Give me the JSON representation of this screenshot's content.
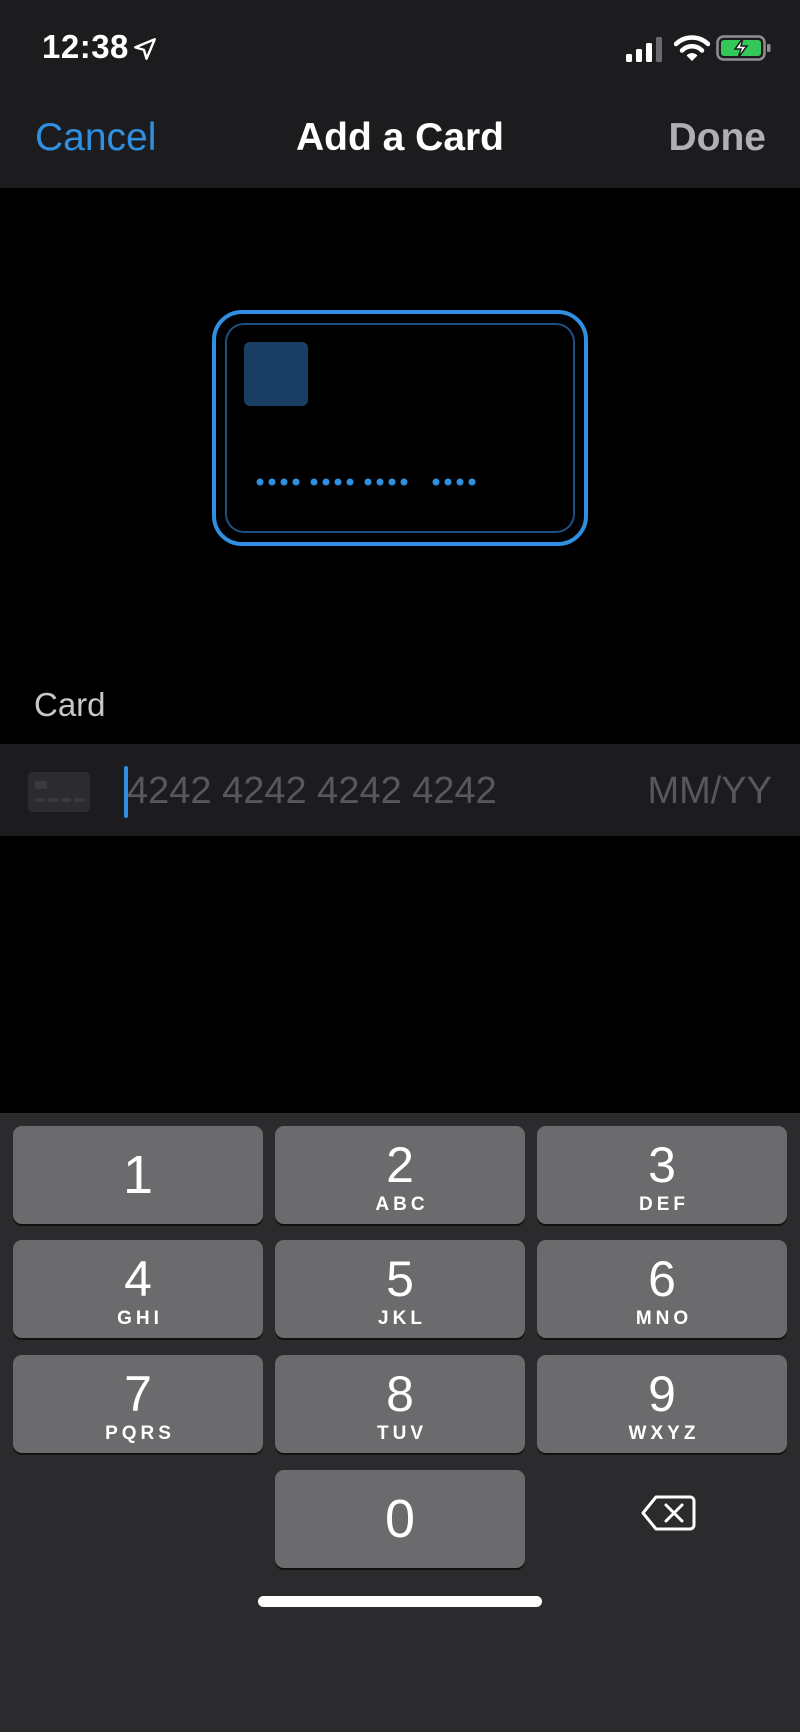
{
  "status_bar": {
    "time": "12:38",
    "icons": [
      "location-arrow-icon",
      "cellular-signal-icon",
      "wifi-icon",
      "battery-charging-icon"
    ]
  },
  "navbar": {
    "cancel_label": "Cancel",
    "title": "Add a Card",
    "done_label": "Done"
  },
  "card_section": {
    "label": "Card",
    "number_placeholder": "4242 4242 4242 4242",
    "expiry_placeholder": "MM/YY"
  },
  "keyboard": {
    "keys": [
      {
        "num": "1",
        "letters": ""
      },
      {
        "num": "2",
        "letters": "ABC"
      },
      {
        "num": "3",
        "letters": "DEF"
      },
      {
        "num": "4",
        "letters": "GHI"
      },
      {
        "num": "5",
        "letters": "JKL"
      },
      {
        "num": "6",
        "letters": "MNO"
      },
      {
        "num": "7",
        "letters": "PQRS"
      },
      {
        "num": "8",
        "letters": "TUV"
      },
      {
        "num": "9",
        "letters": "WXYZ"
      },
      {
        "num": "0",
        "letters": ""
      }
    ]
  },
  "colors": {
    "accent": "#2f8fe0",
    "bar_background": "#1c1c1e",
    "key_background": "#6b6b6d",
    "keyboard_background": "#2b2b2d"
  }
}
